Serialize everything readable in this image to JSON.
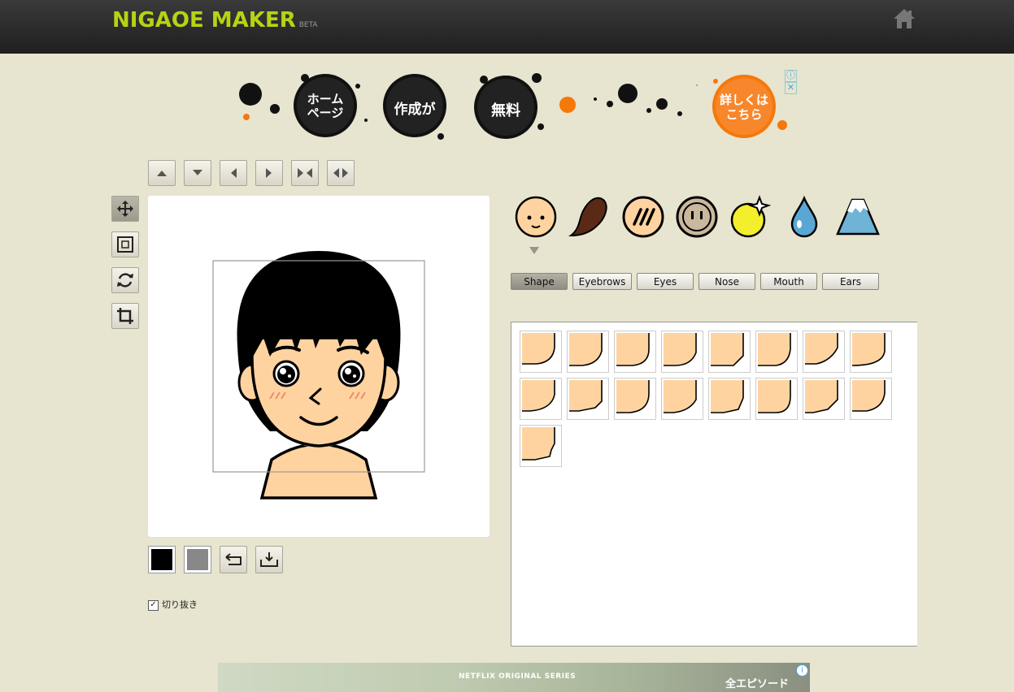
{
  "header": {
    "logo": "NIGAOE MAKER",
    "badge": "BETA",
    "home_icon": "home-icon"
  },
  "ad_top": {
    "bubbles": [
      "ホーム\nページ",
      "作成が",
      "無料"
    ],
    "cta": "詳しくは\nこちら",
    "info_icon": "info-icon",
    "close_icon": "close-icon"
  },
  "toolbar_top": [
    "arrow-up-icon",
    "arrow-down-icon",
    "arrow-left-icon",
    "arrow-right-icon",
    "compress-horizontal-icon",
    "expand-horizontal-icon"
  ],
  "toolbar_left": [
    "move-icon",
    "resize-icon",
    "rotate-icon",
    "crop-icon"
  ],
  "bottom_tools": {
    "color1": "#000000",
    "color2": "#888888",
    "undo_icon": "undo-icon",
    "save_icon": "download-icon"
  },
  "crop_option": {
    "label": "切り抜き",
    "checked": true
  },
  "categories": [
    "face-icon",
    "hair-icon",
    "skin-texture-icon",
    "accessory-icon",
    "highlight-icon",
    "drop-icon",
    "background-icon"
  ],
  "subtabs": [
    {
      "label": "Shape",
      "active": true
    },
    {
      "label": "Eyebrows",
      "active": false
    },
    {
      "label": "Eyes",
      "active": false
    },
    {
      "label": "Nose",
      "active": false
    },
    {
      "label": "Mouth",
      "active": false
    },
    {
      "label": "Ears",
      "active": false
    }
  ],
  "face_shapes_count": 17,
  "ad_bottom": {
    "brand": "NETFLIX ORIGINAL SERIES",
    "text": "全エピソード",
    "info_icon": "info-icon"
  },
  "colors": {
    "accent": "#b7d313",
    "skin": "#ffd3a0",
    "bg": "#e7e4d0"
  }
}
